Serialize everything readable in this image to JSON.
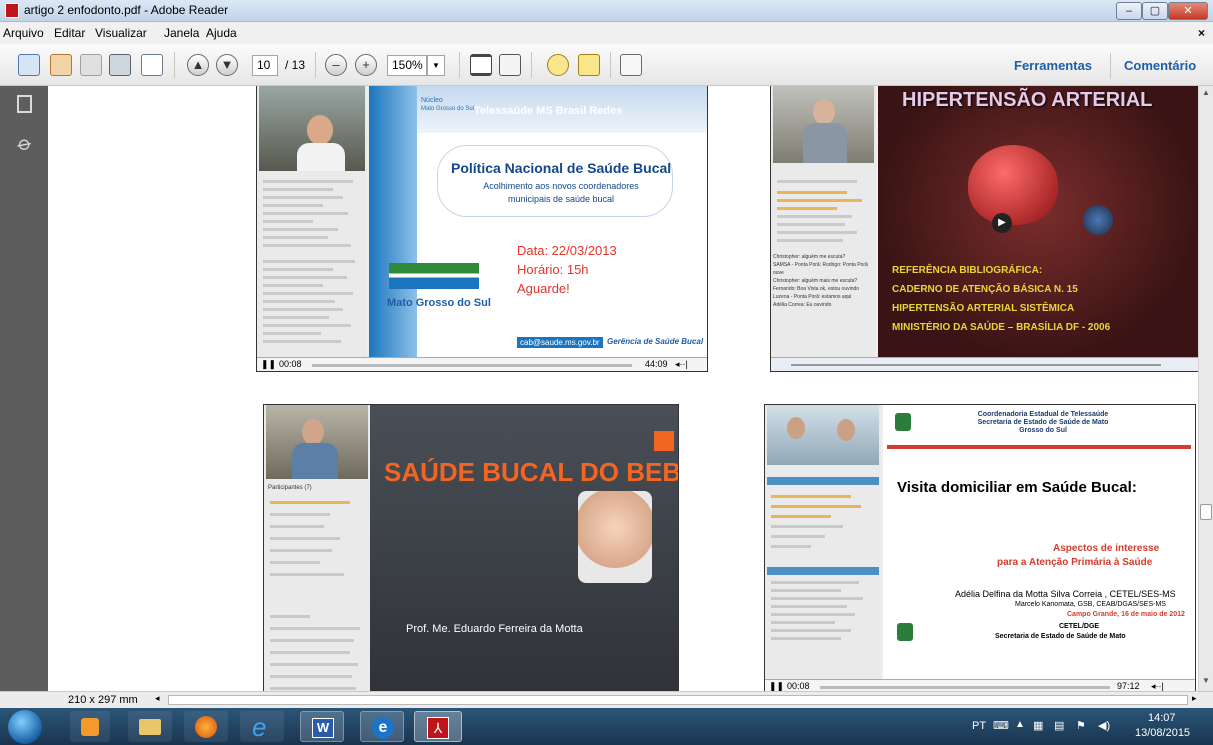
{
  "window": {
    "title": "artigo 2 enfodonto.pdf - Adobe Reader",
    "min": "–",
    "max": "▢",
    "close": "✕"
  },
  "menu": [
    "Arquivo",
    "Editar",
    "Visualizar",
    "Janela",
    "Ajuda"
  ],
  "menu_close": "×",
  "toolbar": {
    "page_current": "10",
    "page_total": "/ 13",
    "zoom": "150%",
    "tools": "Ferramentas",
    "comment": "Comentário"
  },
  "status": {
    "page_size": "210 x 297 mm"
  },
  "slides": {
    "s1": {
      "org_line1": "Núcleo",
      "org_line2": "Mato Grosso do Sul",
      "brand": "Telessaúde MS Brasil Redes",
      "title": "Política Nacional de Saúde Bucal",
      "subtitle": "Acolhimento aos novos coordenadores municipais de saúde bucal",
      "date": "Data: 22/03/2013",
      "time": "Horário: 15h",
      "wait": "Aguarde!",
      "logo": "Mato Grosso do Sul",
      "email": "cab@saude.ms.gov.br",
      "footer": "Gerência de Saúde Bucal",
      "t_now": "00:08",
      "t_total": "44:09"
    },
    "s2": {
      "title": "HIPERTENSÃO ARTERIAL",
      "ref1": "REFERÊNCIA BIBLIOGRÁFICA:",
      "ref2": "CADERNO DE ATENÇÃO BÁSICA N. 15",
      "ref3": "HIPERTENSÃO ARTERIAL SISTÊMICA",
      "ref4": "MINISTÉRIO DA SAÚDE – BRASÍLIA DF - 2006",
      "chat": [
        "Christopher: alguém me escuta?",
        "SAMSA - Ponta Porã: Rodrigo: Ponta Porã ouve",
        "Christopher: alguém mais me escuta?",
        "Fernando: Boa Vista ok, estou ouvindo",
        "Luzena - Ponta Porã: estamos aqui",
        "Adélia Correa: Eu ouvindo"
      ]
    },
    "s3": {
      "title": "SAÚDE BUCAL DO BEBE",
      "author": "Prof. Me. Eduardo Ferreira da Motta",
      "participants": "Participantes (7)"
    },
    "s4": {
      "h1": "Coordenadoria Estadual de Telessaúde",
      "h2": "Secretaria de Estado de Saúde de Mato",
      "h3": "Grosso do Sul",
      "title": "Visita domiciliar em  Saúde Bucal:",
      "sub1": "Aspectos de interesse",
      "sub2": "para a Atenção Primária à Saúde",
      "author": "Adélia Delfina da Motta Silva Correia , CETEL/SES-MS",
      "coauthor": "Marcelo Kanomata, GSB, CEAB/DGAS/SES-MS",
      "place": "Campo Grande, 16 de maio de 2012",
      "f1": "CETEL/DGE",
      "f2": "Secretaria de Estado de Saúde de Mato",
      "t_now": "00:08",
      "t_total": "97:12"
    }
  },
  "taskbar": {
    "lang": "PT",
    "time": "14:07",
    "date": "13/08/2015"
  },
  "colors": {
    "accent": "#1c75bc",
    "reader_red": "#c0141b",
    "slide_dark": "#3a3f46",
    "orange": "#f26522"
  }
}
